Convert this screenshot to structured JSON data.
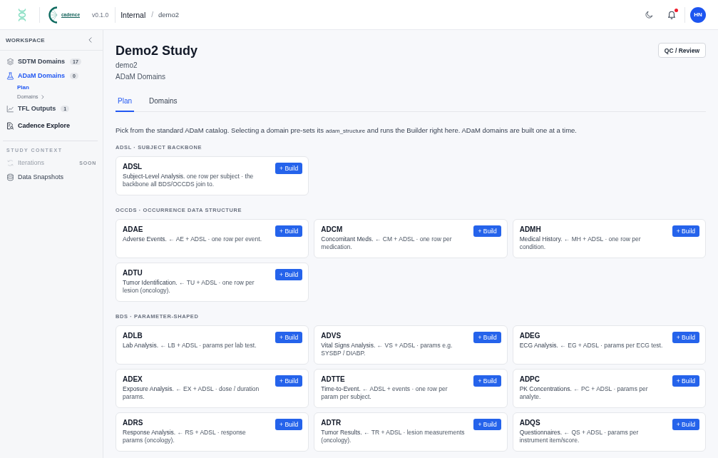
{
  "topbar": {
    "logo_text": "cadence",
    "version": "v0.1.0",
    "breadcrumb": [
      {
        "label": "Internal"
      },
      {
        "label": "demo2"
      }
    ],
    "separator": "/",
    "notifications_unread": true,
    "avatar_initials": "HN"
  },
  "sidebar": {
    "workspace_title": "WORKSPACE",
    "items": [
      {
        "kind": "section",
        "label": "SDTM Domains",
        "count": "17",
        "selected": false
      },
      {
        "kind": "section",
        "label": "ADaM Domains",
        "count": "0",
        "selected": true,
        "children": [
          {
            "kind": "page",
            "label": "Plan",
            "selected": true
          },
          {
            "kind": "group",
            "label": "Domains",
            "selected": false
          }
        ]
      },
      {
        "kind": "section",
        "label": "TFL Outputs",
        "count": "1",
        "selected": false
      },
      {
        "kind": "tool",
        "label": "Cadence Explore",
        "selected": false
      }
    ],
    "context_title": "STUDY CONTEXT",
    "context_items": [
      {
        "label": "Iterations",
        "badge": "SOON",
        "disabled": true
      },
      {
        "label": "Data Snapshots",
        "disabled": false
      }
    ]
  },
  "main": {
    "header": {
      "title": "Demo2 Study",
      "subtitle": "demo2",
      "section": "ADaM Domains",
      "review_button": "QC / Review"
    },
    "tabs": [
      {
        "label": "Plan",
        "selected": true
      },
      {
        "label": "Domains",
        "selected": false
      }
    ],
    "intro": {
      "before": "Pick from the standard ADaM catalog. Selecting a domain pre-sets its",
      "code": "adam_structure",
      "after": "and runs the Builder right here. ADaM domains are built one at a time."
    },
    "groups": [
      {
        "label": "ADSL · SUBJECT BACKBONE",
        "domains": [
          {
            "code": "ADSL",
            "title": "Subject-Level Analysis.",
            "description": "one row per subject · the backbone all BDS/OCCDS join to.",
            "action": "+ Build"
          }
        ]
      },
      {
        "label": "OCCDS · OCCURRENCE DATA STRUCTURE",
        "domains": [
          {
            "code": "ADAE",
            "title": "Adverse Events.",
            "description": "← AE + ADSL · one row per event.",
            "action": "+ Build"
          },
          {
            "code": "ADCM",
            "title": "Concomitant Meds.",
            "description": "← CM + ADSL · one row per medication.",
            "action": "+ Build"
          },
          {
            "code": "ADMH",
            "title": "Medical History.",
            "description": "← MH + ADSL · one row per condition.",
            "action": "+ Build"
          },
          {
            "code": "ADTU",
            "title": "Tumor Identification.",
            "description": "← TU + ADSL · one row per lesion (oncology).",
            "action": "+ Build"
          }
        ]
      },
      {
        "label": "BDS · PARAMETER-SHAPED",
        "domains": [
          {
            "code": "ADLB",
            "title": "Lab Analysis.",
            "description": "← LB + ADSL · params per lab test.",
            "action": "+ Build"
          },
          {
            "code": "ADVS",
            "title": "Vital Signs Analysis.",
            "description": "← VS + ADSL · params e.g. SYSBP / DIABP.",
            "action": "+ Build"
          },
          {
            "code": "ADEG",
            "title": "ECG Analysis.",
            "description": "← EG + ADSL · params per ECG test.",
            "action": "+ Build"
          },
          {
            "code": "ADEX",
            "title": "Exposure Analysis.",
            "description": "← EX + ADSL · dose / duration params.",
            "action": "+ Build"
          },
          {
            "code": "ADTTE",
            "title": "Time-to-Event.",
            "description": "← ADSL + events · one row per param per subject.",
            "action": "+ Build"
          },
          {
            "code": "ADPC",
            "title": "PK Concentrations.",
            "description": "← PC + ADSL · params per analyte.",
            "action": "+ Build"
          },
          {
            "code": "ADRS",
            "title": "Response Analysis.",
            "description": "← RS + ADSL · response params (oncology).",
            "action": "+ Build"
          },
          {
            "code": "ADTR",
            "title": "Tumor Results.",
            "description": "← TR + ADSL · lesion measurements (oncology).",
            "action": "+ Build"
          },
          {
            "code": "ADQS",
            "title": "Questionnaires.",
            "description": "← QS + ADSL · params per instrument item/score.",
            "action": "+ Build"
          }
        ]
      }
    ]
  }
}
